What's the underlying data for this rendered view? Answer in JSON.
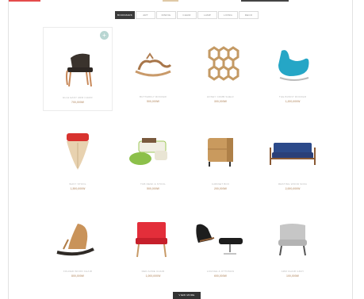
{
  "accent_colors": {
    "top_red": "#e44c4c",
    "top_dark": "#333333",
    "badge": "#b9d6d2",
    "price": "#c8a98c"
  },
  "filter_tabs": [
    {
      "label": "BOOKMARK",
      "active": true
    },
    {
      "label": "ART"
    },
    {
      "label": "DINING"
    },
    {
      "label": "CHAIR"
    },
    {
      "label": "LAMP"
    },
    {
      "label": "LIVING"
    },
    {
      "label": "DECO"
    }
  ],
  "products": [
    {
      "name": "ELLE EASY ARM CHAIR",
      "price": "700,000W",
      "badge": "+",
      "icon": "chair-icon"
    },
    {
      "name": "BUTTERFLY ROCKER",
      "price": "500,000W",
      "icon": "rocker-icon"
    },
    {
      "name": "HONEY COMB SHELF",
      "price": "300,000W",
      "icon": "shelf-icon"
    },
    {
      "name": "THE BUNNY ROCKER",
      "price": "1,200,000W",
      "icon": "rocker-icon"
    },
    {
      "name": "WAVY STOOL",
      "price": "1,500,000W",
      "icon": "stool-icon"
    },
    {
      "name": "TUB DESK & STOOL",
      "price": "500,000W",
      "icon": "desk-icon"
    },
    {
      "name": "CABINET BOX",
      "price": "200,000W",
      "icon": "cabinet-icon"
    },
    {
      "name": "RESTING WOOD SOFA",
      "price": "2,000,000W",
      "icon": "sofa-icon"
    },
    {
      "name": "FOLDED WOOD CHAIR",
      "price": "800,000W",
      "icon": "chair-icon"
    },
    {
      "name": "RED ACME CHAIR",
      "price": "1,000,000W",
      "icon": "chair-icon"
    },
    {
      "name": "LOUNGE & OTTOMAN",
      "price": "600,000W",
      "icon": "lounge-icon"
    },
    {
      "name": "ARM CHAIR GRAY",
      "price": "100,000W",
      "icon": "chair-icon"
    }
  ],
  "view_more_label": "VIEW MORE"
}
